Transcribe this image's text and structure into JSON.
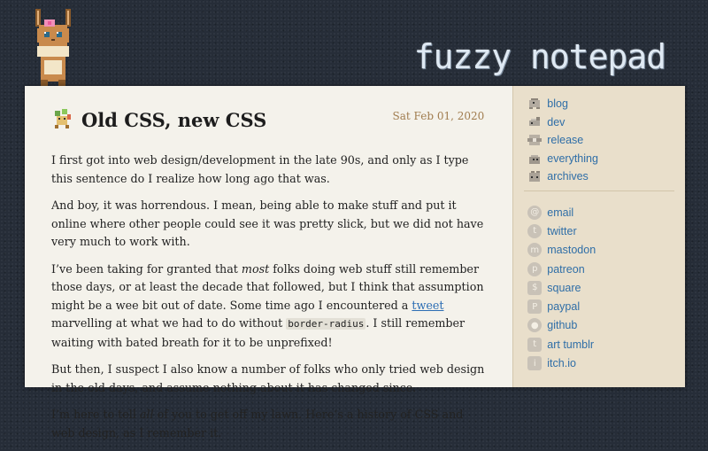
{
  "site": {
    "title": "fuzzy notepad"
  },
  "post": {
    "title": "Old CSS, new CSS",
    "date": "Sat Feb 01, 2020",
    "p1": "I first got into web design/development in the late 90s, and only as I type this sentence do I realize how long ago that was.",
    "p2": "And boy, it was horrendous. I mean, being able to make stuff and put it online where other people could see it was pretty slick, but we did not have very much to work with.",
    "p3_a": "I’ve been taking for granted that ",
    "p3_em": "most",
    "p3_b": " folks doing web stuff still remember those days, or at least the decade that followed, but I think that assumption might be a wee bit out of date. Some time ago I encountered a ",
    "p3_link": "tweet",
    "p3_c": " marvelling at what we had to do without ",
    "p3_code": "border-radius",
    "p3_d": ". I still remember waiting with bated breath for it to be unprefixed!",
    "p4": "But then, I suspect I also know a number of folks who only tried web design in the old days, and assume nothing about it has changed since.",
    "p5_a": "I’m here to tell ",
    "p5_em": "all",
    "p5_b": " of you to get off my lawn. Here’s a history of CSS and web design, as I remember it."
  },
  "nav": {
    "primary": [
      {
        "label": "blog",
        "icon": "blog-pokemon-icon"
      },
      {
        "label": "dev",
        "icon": "dev-pokemon-icon"
      },
      {
        "label": "release",
        "icon": "release-pokemon-icon"
      },
      {
        "label": "everything",
        "icon": "everything-pokemon-icon"
      },
      {
        "label": "archives",
        "icon": "archives-pokemon-icon"
      }
    ],
    "social": [
      {
        "label": "email",
        "icon": "email-icon"
      },
      {
        "label": "twitter",
        "icon": "twitter-icon"
      },
      {
        "label": "mastodon",
        "icon": "mastodon-icon"
      },
      {
        "label": "patreon",
        "icon": "patreon-icon"
      },
      {
        "label": "square",
        "icon": "square-icon"
      },
      {
        "label": "paypal",
        "icon": "paypal-icon"
      },
      {
        "label": "github",
        "icon": "github-icon"
      },
      {
        "label": "art tumblr",
        "icon": "tumblr-icon"
      },
      {
        "label": "itch.io",
        "icon": "itchio-icon"
      }
    ]
  },
  "colors": {
    "link": "#2f6ea7",
    "date": "#a07c4e",
    "sidebar": "#e9dfcb",
    "page": "#f4f2eb"
  }
}
